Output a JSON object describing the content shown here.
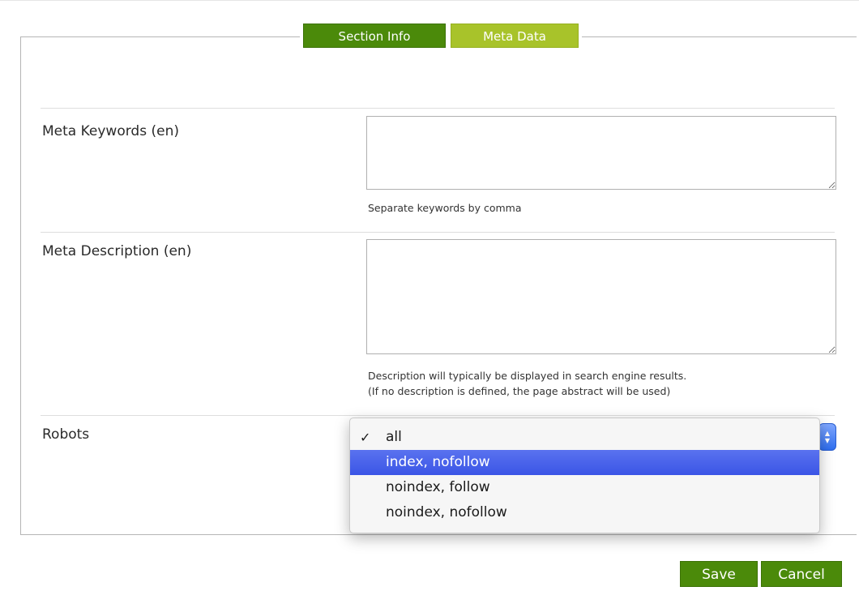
{
  "tabs": {
    "section_info": "Section Info",
    "meta_data": "Meta Data"
  },
  "fields": {
    "keywords": {
      "label": "Meta Keywords (en)",
      "value": "",
      "hint": "Separate keywords by comma"
    },
    "description": {
      "label": "Meta Description (en)",
      "value": "",
      "hint_line1": "Description will typically be displayed in search engine results.",
      "hint_line2": "(If no description is defined, the page abstract will be used)"
    },
    "robots": {
      "label": "Robots",
      "selected": "all",
      "check_mark": "✓",
      "options": [
        "all",
        "index, nofollow",
        "noindex, follow",
        "noindex, nofollow"
      ],
      "highlighted": "index, nofollow"
    }
  },
  "buttons": {
    "save": "Save",
    "cancel": "Cancel"
  },
  "colors": {
    "tab_active": "#4b8a0a",
    "tab_inactive": "#a8c32a",
    "button": "#4b8a0a",
    "highlight": "#3b55e6"
  }
}
